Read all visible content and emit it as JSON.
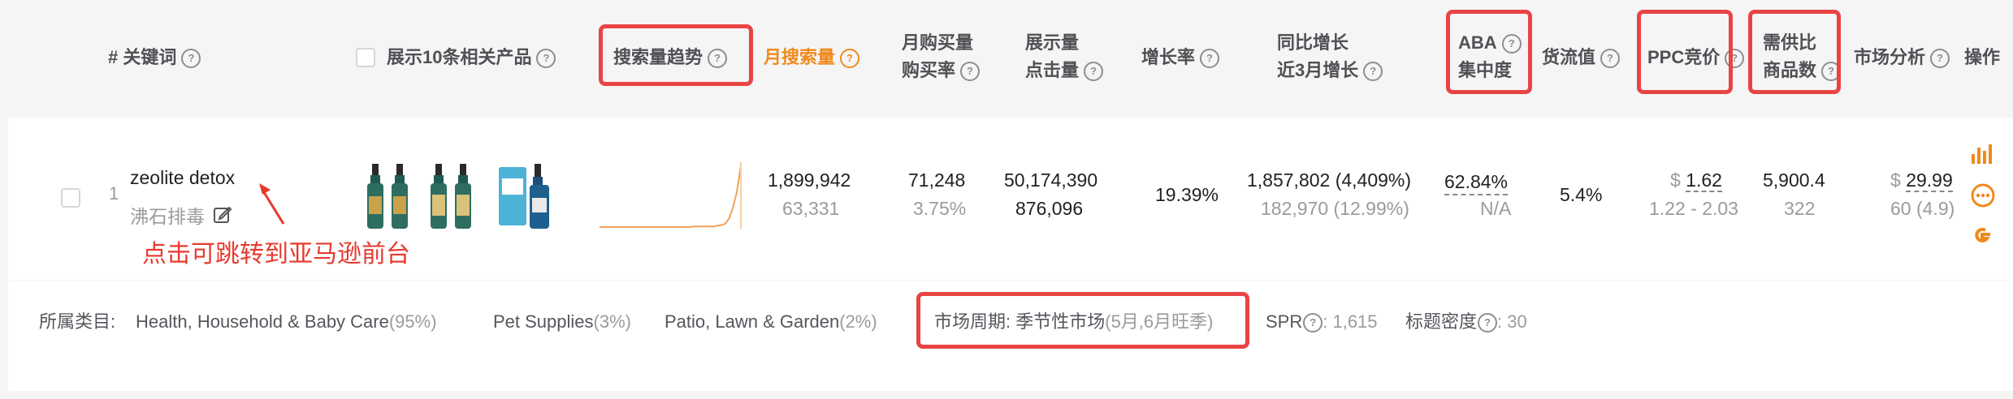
{
  "header": {
    "col_keyword": "# 关键词",
    "col_show10": "展示10条相关产品",
    "col_trend": "搜索量趋势",
    "col_monthly_search": "月搜索量",
    "col_monthly_buy_1": "月购买量",
    "col_monthly_buy_2": "购买率",
    "col_impressions_1": "展示量",
    "col_impressions_2": "点击量",
    "col_growth": "增长率",
    "col_yoy_1": "同比增长",
    "col_yoy_2": "近3月增长",
    "col_aba_1": "ABA",
    "col_aba_2": "集中度",
    "col_flow": "货流值",
    "col_ppc": "PPC竞价",
    "col_supply_1": "需供比",
    "col_supply_2": "商品数",
    "col_market": "市场分析",
    "col_action": "操作"
  },
  "row": {
    "index": "1",
    "keyword": "zeolite detox",
    "keyword_cn": "沸石排毒",
    "annotation": "点击可跳转到亚马逊前台",
    "monthly_search": "1,899,942",
    "monthly_search_sub": "63,331",
    "monthly_buy": "71,248",
    "buy_rate": "3.75%",
    "impressions": "50,174,390",
    "clicks": "876,096",
    "growth": "19.39%",
    "yoy": "1,857,802 (4,409%)",
    "recent3m": "182,970 (12.99%)",
    "aba": "62.84%",
    "aba_sub": "N/A",
    "flow": "5.4%",
    "ppc_currency": "$",
    "ppc": "1.62",
    "ppc_range": "1.22 - 2.03",
    "supply_ratio": "5,900.4",
    "product_count": "322",
    "market_currency": "$",
    "market_price": "29.99",
    "market_sub": "60 (4.9)",
    "trend_values": [
      5,
      5,
      5,
      5,
      5,
      5,
      5,
      5,
      5,
      5,
      5,
      5,
      5,
      5,
      5,
      5,
      5,
      5,
      5,
      5,
      5,
      5,
      5,
      5,
      6,
      6,
      6,
      6,
      6,
      6,
      7,
      8,
      10,
      18,
      35,
      60,
      100
    ]
  },
  "footer": {
    "category_label": "所属类目:",
    "cat1": "Health, Household & Baby Care",
    "cat1_pct": "(95%)",
    "cat2": "Pet Supplies",
    "cat2_pct": "(3%)",
    "cat3": "Patio, Lawn & Garden",
    "cat3_pct": "(2%)",
    "cycle_label": "市场周期: ",
    "cycle_value": "季节性市场",
    "cycle_detail": "(5月,6月旺季)",
    "spr_label": "SPR",
    "spr_value": ": 1,615",
    "title_density_label": "标题密度",
    "title_density_value": ": 30"
  },
  "colors": {
    "orange": "#f08a1c",
    "highlight": "#e84444",
    "annotation": "#e63a2e"
  }
}
